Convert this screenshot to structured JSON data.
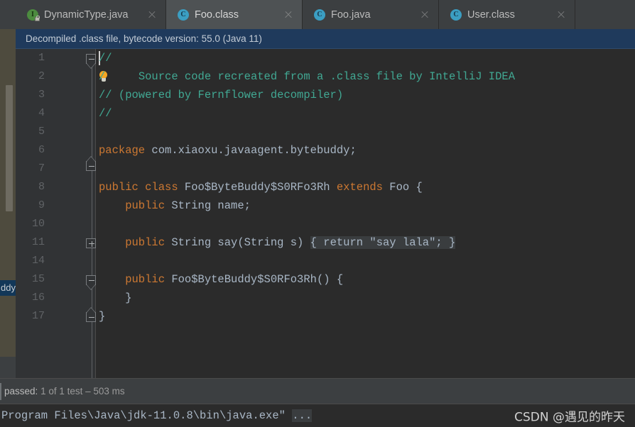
{
  "tabs": [
    {
      "label": "DynamicType.java",
      "icon": "interface-icon",
      "icon_kind": "iface",
      "locked": true,
      "active": false,
      "close": "close-icon"
    },
    {
      "label": "Foo.class",
      "icon": "class-icon",
      "icon_kind": "klass",
      "locked": false,
      "active": true,
      "close": "close-icon"
    },
    {
      "label": "Foo.java",
      "icon": "class-icon",
      "icon_kind": "klass",
      "locked": false,
      "active": false,
      "close": "close-icon"
    },
    {
      "label": "User.class",
      "icon": "class-icon",
      "icon_kind": "klass",
      "locked": false,
      "active": false,
      "close": "close-icon"
    }
  ],
  "banner": {
    "text": "Decompiled .class file, bytecode version: 55.0 (Java 11)",
    "background": "#1f3a5c"
  },
  "project_panel": {
    "selected_item_label": "ddy"
  },
  "editor": {
    "gutter_line_numbers": [
      "1",
      "2",
      "3",
      "4",
      "5",
      "6",
      "7",
      "8",
      "9",
      "10",
      "11",
      "14",
      "15",
      "16",
      "17"
    ],
    "caret_line": 1,
    "bulb_icon": "lightbulb-icon",
    "lines": [
      {
        "num": "1",
        "segments": [
          {
            "text": "//",
            "style": "cmt"
          }
        ]
      },
      {
        "num": "2",
        "segments": [
          {
            "text": "/",
            "style": "cmt"
          },
          {
            "text": "     Source code recreated from a .class file by IntelliJ IDEA",
            "style": "cmt"
          }
        ]
      },
      {
        "num": "3",
        "segments": [
          {
            "text": "// (powered by Fernflower decompiler)",
            "style": "cmt"
          }
        ]
      },
      {
        "num": "4",
        "segments": [
          {
            "text": "//",
            "style": "cmt"
          }
        ]
      },
      {
        "num": "5",
        "segments": []
      },
      {
        "num": "6",
        "segments": [
          {
            "text": "package",
            "style": "kw"
          },
          {
            "text": " com.xiaoxu.javaagent.bytebuddy;",
            "style": "typ"
          }
        ]
      },
      {
        "num": "7",
        "segments": []
      },
      {
        "num": "8",
        "segments": [
          {
            "text": "public class",
            "style": "kw"
          },
          {
            "text": " Foo$ByteBuddy$S0RFo3Rh ",
            "style": "typ"
          },
          {
            "text": "extends",
            "style": "kw"
          },
          {
            "text": " Foo {",
            "style": "typ"
          }
        ]
      },
      {
        "num": "9",
        "segments": [
          {
            "text": "    public",
            "style": "kw"
          },
          {
            "text": " String name;",
            "style": "typ"
          }
        ]
      },
      {
        "num": "10",
        "segments": []
      },
      {
        "num": "11",
        "segments": [
          {
            "text": "    public",
            "style": "kw"
          },
          {
            "text": " String say(String s) ",
            "style": "typ"
          },
          {
            "text": "{ ",
            "style": "fld"
          },
          {
            "text": "return ",
            "style": "kwfld"
          },
          {
            "text": "\"say lala\"",
            "style": "strfld"
          },
          {
            "text": "; ",
            "style": "fld"
          },
          {
            "text": "}",
            "style": "fld"
          }
        ]
      },
      {
        "num": "14",
        "segments": []
      },
      {
        "num": "15",
        "segments": [
          {
            "text": "    public",
            "style": "kw"
          },
          {
            "text": " Foo$ByteBuddy$S0RFo3Rh() {",
            "style": "typ"
          }
        ]
      },
      {
        "num": "16",
        "segments": [
          {
            "text": "    }",
            "style": "typ"
          }
        ]
      },
      {
        "num": "17",
        "segments": [
          {
            "text": "}",
            "style": "typ"
          }
        ]
      }
    ]
  },
  "test_status": {
    "prefix": "passed:",
    "summary": "1 of 1 test",
    "separator": "–",
    "duration": "503 ms"
  },
  "console": {
    "text": "Program Files\\Java\\jdk-11.0.8\\bin\\java.exe\"",
    "ellipsis": "..."
  },
  "watermark": {
    "text": "CSDN @遇见的昨天"
  }
}
